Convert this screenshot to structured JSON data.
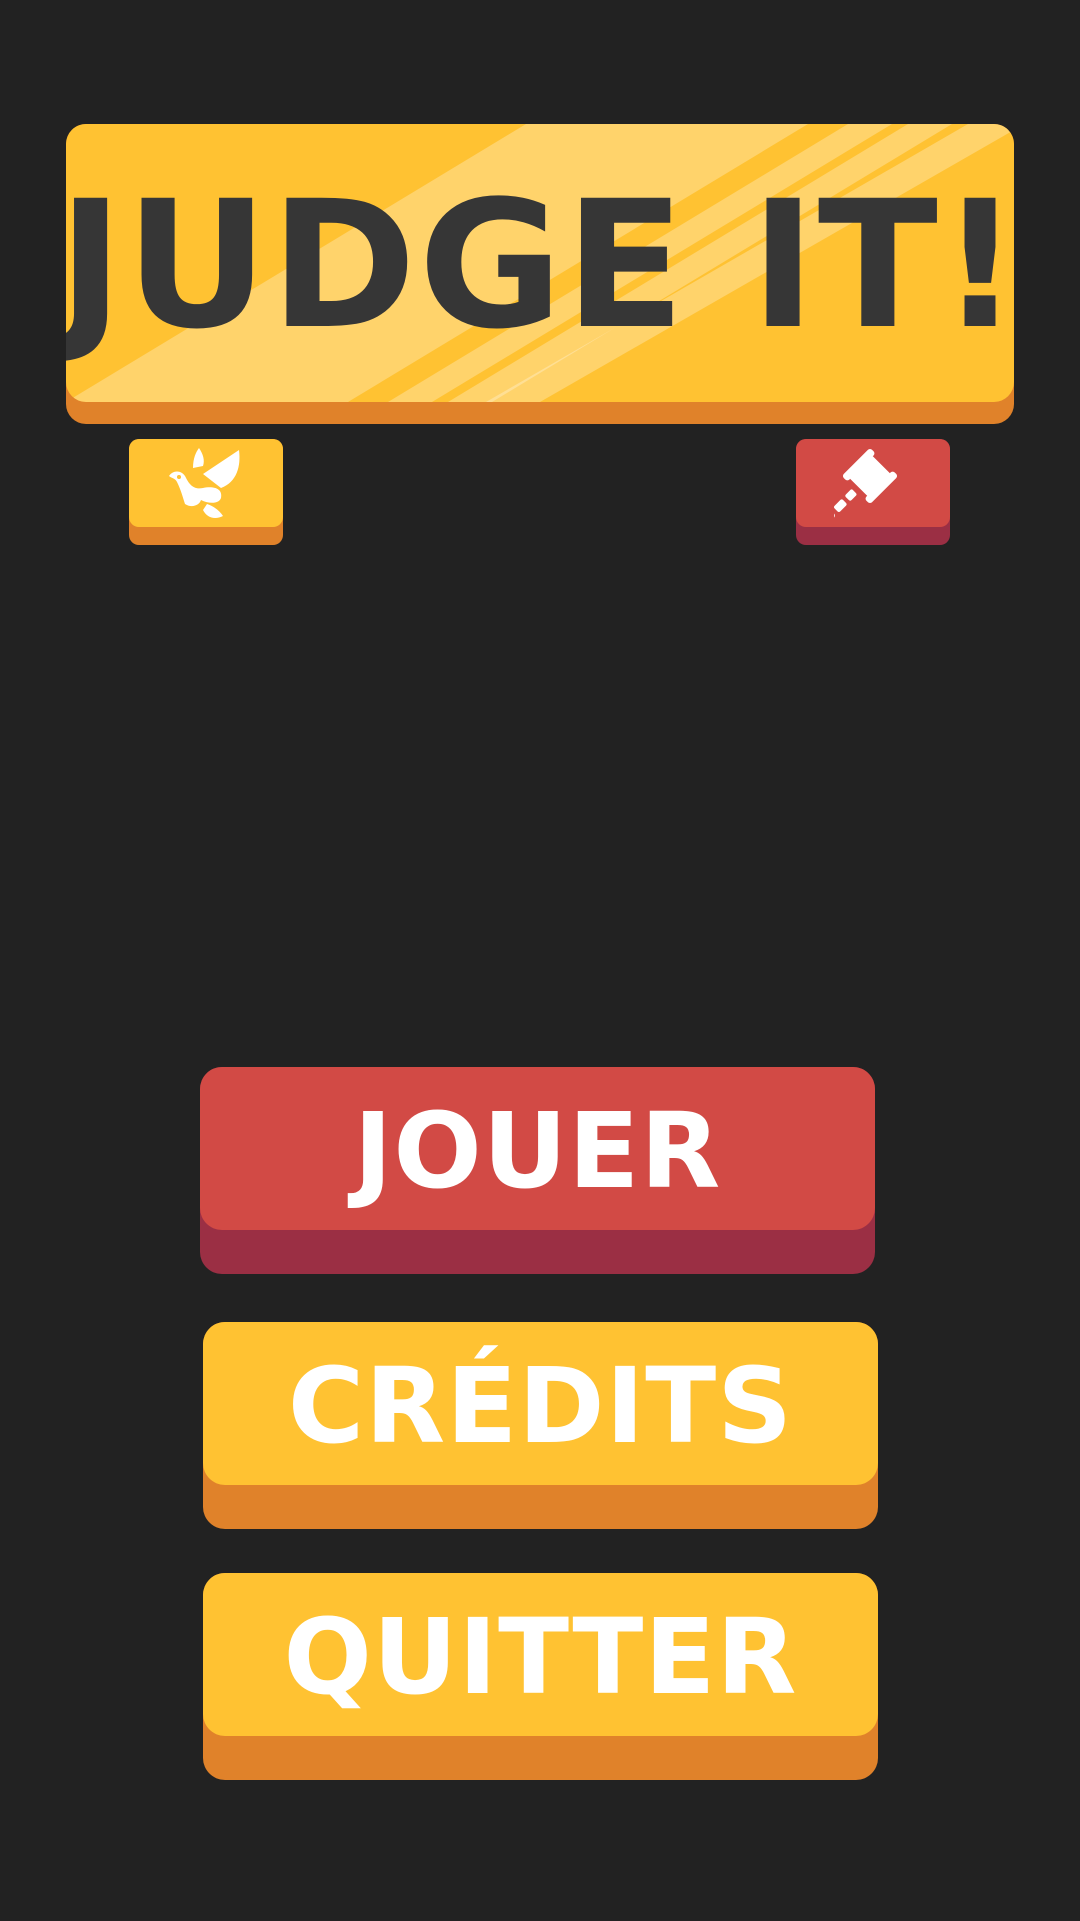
{
  "title": {
    "text": "JUDGE IT!"
  },
  "icons": {
    "peace": "dove-icon",
    "judge": "gavel-icon"
  },
  "menu": {
    "play_label": "JOUER",
    "credits_label": "CRÉDITS",
    "quit_label": "QUITTER"
  },
  "colors": {
    "background": "#222222",
    "yellow": "#FFC232",
    "orange_shadow": "#E0822A",
    "red": "#D24A45",
    "dark_red_shadow": "#9B2F44",
    "title_text": "#363636",
    "button_text": "#FFFFFF"
  }
}
